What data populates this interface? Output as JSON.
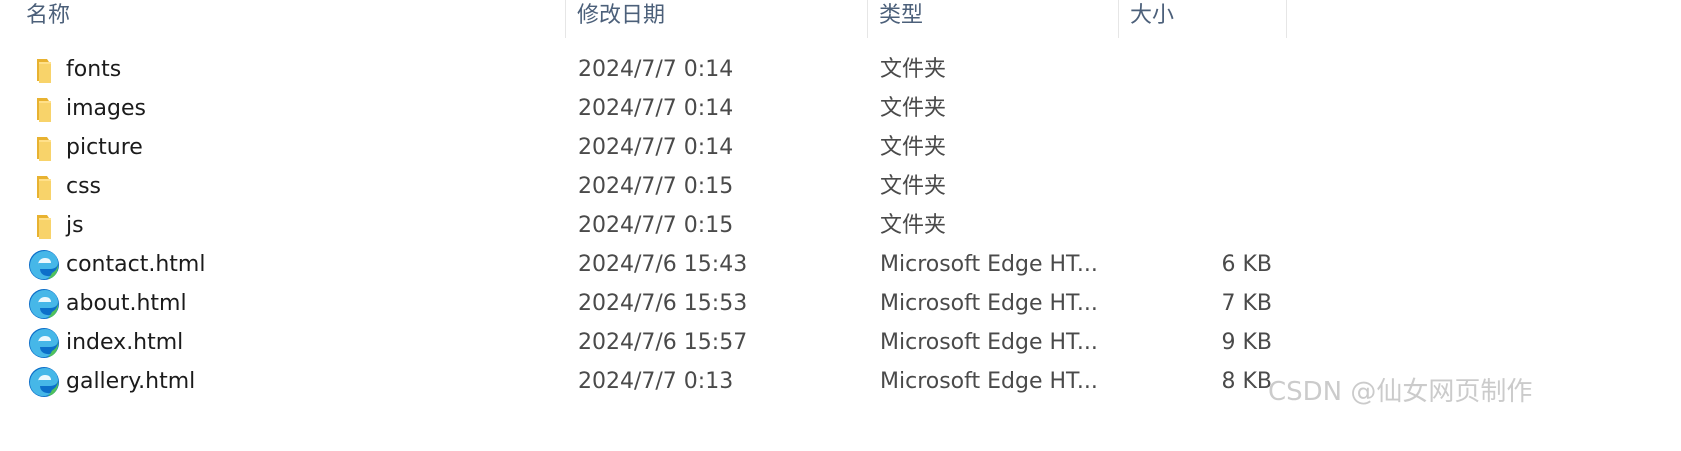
{
  "columns": {
    "name": "名称",
    "modified": "修改日期",
    "type": "类型",
    "size": "大小"
  },
  "files": [
    {
      "name": "fonts",
      "modified": "2024/7/7 0:14",
      "type": "文件夹",
      "size": "",
      "icon": "folder-icon"
    },
    {
      "name": "images",
      "modified": "2024/7/7 0:14",
      "type": "文件夹",
      "size": "",
      "icon": "folder-icon"
    },
    {
      "name": "picture",
      "modified": "2024/7/7 0:14",
      "type": "文件夹",
      "size": "",
      "icon": "folder-icon"
    },
    {
      "name": "css",
      "modified": "2024/7/7 0:15",
      "type": "文件夹",
      "size": "",
      "icon": "folder-icon"
    },
    {
      "name": "js",
      "modified": "2024/7/7 0:15",
      "type": "文件夹",
      "size": "",
      "icon": "folder-icon"
    },
    {
      "name": "contact.html",
      "modified": "2024/7/6 15:43",
      "type": "Microsoft Edge HT...",
      "size": "6 KB",
      "icon": "edge-html-icon"
    },
    {
      "name": "about.html",
      "modified": "2024/7/6 15:53",
      "type": "Microsoft Edge HT...",
      "size": "7 KB",
      "icon": "edge-html-icon"
    },
    {
      "name": "index.html",
      "modified": "2024/7/6 15:57",
      "type": "Microsoft Edge HT...",
      "size": "9 KB",
      "icon": "edge-html-icon"
    },
    {
      "name": "gallery.html",
      "modified": "2024/7/7 0:13",
      "type": "Microsoft Edge HT...",
      "size": "8 KB",
      "icon": "edge-html-icon"
    }
  ],
  "watermark": "CSDN @仙女网页制作",
  "colors": {
    "header_text": "#4c607a",
    "folder_yellow": "#f5c84c",
    "edge_blue": "#0c6fc9",
    "edge_green": "#4fc15c"
  }
}
